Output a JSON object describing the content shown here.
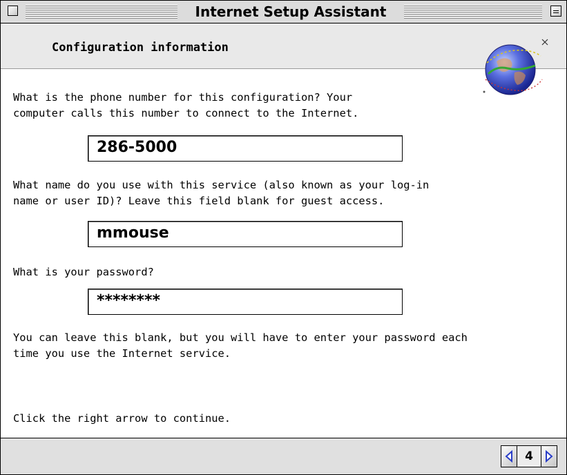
{
  "window": {
    "title": "Internet Setup Assistant"
  },
  "header": {
    "title": "Configuration information",
    "icon": "globe-icon"
  },
  "questions": {
    "phone_line1": "What is the phone number for this configuration?  Your",
    "phone_line2": "computer calls this number to connect to the Internet.",
    "name_line1": "What name do you use with this service (also known as your log-in",
    "name_line2": "name or user ID)?  Leave this field blank for guest access.",
    "password_line1": "What is your password?",
    "note_line1": "You can leave this blank, but you will have to enter your password each",
    "note_line2": "time you use the Internet service.",
    "continue": "Click the right arrow to continue."
  },
  "fields": {
    "phone": "286-5000",
    "username": "mmouse",
    "password": "********"
  },
  "footer": {
    "page_number": "4",
    "back_icon": "left-arrow-icon",
    "forward_icon": "right-arrow-icon"
  },
  "colors": {
    "arrow_blue": "#2a3ec8",
    "header_bg": "#e9e9e9",
    "footer_bg": "#e0e0e0"
  }
}
